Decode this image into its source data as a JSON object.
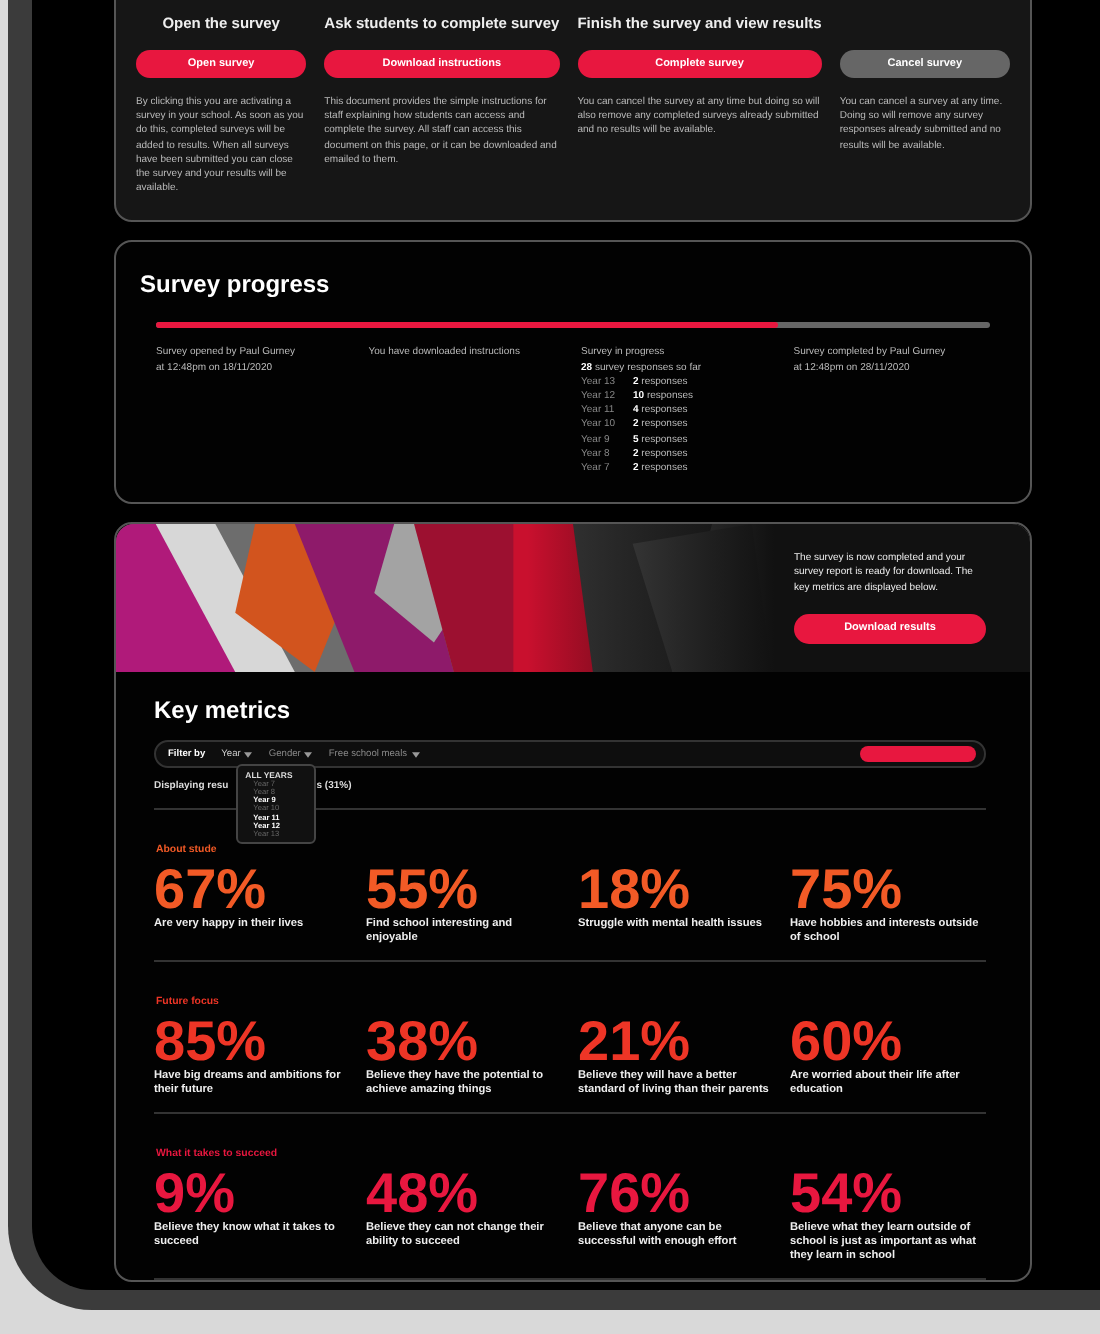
{
  "steps": [
    {
      "heading": "Open the survey",
      "button": {
        "label": "Open survey",
        "kind": "primary"
      },
      "description": "By clicking this you are activating a survey in your school. As soon as you do this, completed surveys will be added to results. When all surveys have been submitted you can close the survey and your results will be available."
    },
    {
      "heading": "Ask students to complete survey",
      "button": {
        "label": "Download instructions",
        "kind": "primary"
      },
      "description": "This document provides the simple instructions for staff explaining how students can access and complete the survey. All staff can access this document on this page, or it can be downloaded and emailed to them."
    },
    {
      "heading": "Finish the survey and view results",
      "button": {
        "label": "Complete survey",
        "kind": "primary"
      },
      "description": "You can cancel the survey at any time but doing so will also remove any completed surveys already submitted and no results will be available."
    },
    {
      "button": {
        "label": "Cancel survey",
        "kind": "secondary"
      },
      "description": "You can cancel a survey at any time. Doing so will remove any survey responses already submitted and no results will be available."
    }
  ],
  "progress": {
    "title": "Survey progress",
    "level": 0.745,
    "milestones": [
      {
        "lines": [
          "Survey opened by Paul Gurney",
          "at 12:48pm on 18/11/2020"
        ]
      },
      {
        "lines": [
          "You have downloaded instructions"
        ]
      },
      {
        "lines": [
          "Survey in progress",
          "**28** survey responses so far"
        ],
        "years": [
          {
            "year": "Year 13",
            "responses": "**2** responses"
          },
          {
            "year": "Year 12",
            "responses": "**10** responses"
          },
          {
            "year": "Year 11",
            "responses": "**4** responses"
          },
          {
            "year": "Year 10",
            "responses": "**2** responses"
          },
          {
            "year": "Year 9",
            "responses": "**5** responses"
          },
          {
            "year": "Year 8",
            "responses": "**2** responses"
          },
          {
            "year": "Year 7",
            "responses": "**2** responses"
          }
        ]
      },
      {
        "lines": [
          "Survey completed by Paul Gurney",
          "at 12:48pm on 28/11/2020"
        ]
      }
    ]
  },
  "banner": {
    "text": "The survey is now completed and your survey report is ready for download. The key metrics are displayed below.",
    "button": "Download results"
  },
  "key_metrics": {
    "title": "Key metrics",
    "filter": {
      "label": "Filter by",
      "options": [
        {
          "label": "Year",
          "expanded": true
        },
        {
          "label": "Gender",
          "expanded": false
        },
        {
          "label": "Free school meals",
          "expanded": false
        }
      ],
      "dropdown": {
        "heading": "ALL YEARS",
        "items": [
          {
            "label": "Year 7",
            "selected": false
          },
          {
            "label": "Year 8",
            "selected": false
          },
          {
            "label": "Year 9",
            "selected": true
          },
          {
            "label": "Year 10",
            "selected": false
          },
          {
            "label": "Year 11",
            "selected": true
          },
          {
            "label": "Year 12",
            "selected": true
          },
          {
            "label": "Year 13",
            "selected": false
          }
        ]
      }
    },
    "displaying": [
      "Displaying resu",
      "s (31%)"
    ],
    "sections": [
      {
        "title": "About stude",
        "color": "#f25a26",
        "metrics": [
          {
            "value": "67%",
            "description": "Are very happy in their lives"
          },
          {
            "value": "55%",
            "description": "Find school interesting and enjoyable"
          },
          {
            "value": "18%",
            "description": "Struggle with mental health issues"
          },
          {
            "value": "75%",
            "description": "Have hobbies and interests outside of school"
          }
        ]
      },
      {
        "title": "Future focus",
        "color": "#ee3526",
        "metrics": [
          {
            "value": "85%",
            "description": "Have big dreams and ambitions for their future"
          },
          {
            "value": "38%",
            "description": "Believe they have the potential to achieve amazing things"
          },
          {
            "value": "21%",
            "description": "Believe they will have a better standard of living than their parents"
          },
          {
            "value": "60%",
            "description": "Are worried about their life after education"
          }
        ]
      },
      {
        "title": "What it takes to succeed",
        "color": "#e8173f",
        "metrics": [
          {
            "value": "9%",
            "description": "Believe they know what it takes to succeed"
          },
          {
            "value": "48%",
            "description": "Believe they can not change their ability to succeed"
          },
          {
            "value": "76%",
            "description": "Believe that anyone can be successful with enough effort"
          },
          {
            "value": "54%",
            "description": "Believe what they learn outside of school is just as important as what they learn in school"
          }
        ]
      }
    ]
  }
}
